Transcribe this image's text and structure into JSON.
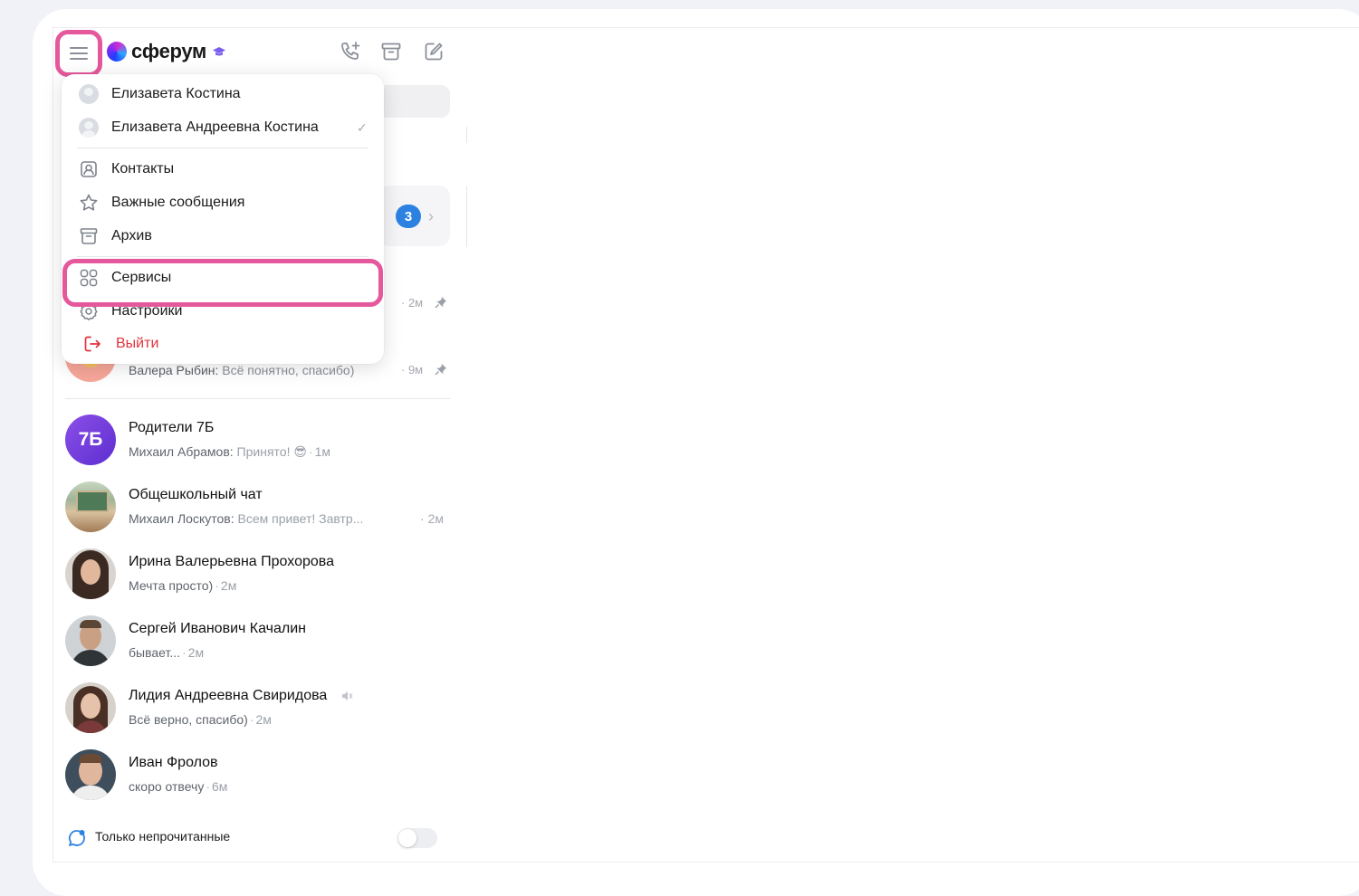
{
  "header": {
    "app_name": "сферум"
  },
  "background_chat": {
    "folder_badge_count": "3",
    "row1_time": "· 2м",
    "row2_preview_sender": "Валера Рыбин:",
    "row2_preview_text": " Всё понятно, спасибо)",
    "row2_time": "· 9м"
  },
  "menu": {
    "accounts": [
      {
        "name": "Елизавета Костина",
        "selected": false
      },
      {
        "name": "Елизавета Андреевна Костина",
        "selected": true
      }
    ],
    "items": {
      "contacts": "Контакты",
      "starred": "Важные сообщения",
      "archive": "Архив",
      "services": "Сервисы",
      "settings": "Настройки",
      "logout": "Выйти"
    }
  },
  "chats": [
    {
      "name": "Родители 7Б",
      "sender": "Михаил Абрамов:",
      "text": " Принято! 😎",
      "time": "1м",
      "avatar_text": "7Б"
    },
    {
      "name": "Общешкольный чат",
      "sender": "Михаил Лоскутов:",
      "text": " Всем привет! Завтр...",
      "time": "· 2м"
    },
    {
      "name": "Ирина Валерьевна Прохорова",
      "sender": "",
      "text": "Мечта просто)",
      "time": "2м"
    },
    {
      "name": "Сергей Иванович Качалин",
      "sender": "",
      "text": "бывает...",
      "time": "2м"
    },
    {
      "name": "Лидия Андреевна Свиридова",
      "sender": "",
      "text": "Всё верно, спасибо)",
      "time": "2м"
    },
    {
      "name": "Иван Фролов",
      "sender": "",
      "text": "скоро отвечу",
      "time": "6м"
    }
  ],
  "footer": {
    "unread_only_label": "Только непрочитанные",
    "toggle_on": false
  },
  "colors": {
    "highlight": "#e5589c",
    "badge": "#2d81e0",
    "logout": "#e0333c"
  }
}
